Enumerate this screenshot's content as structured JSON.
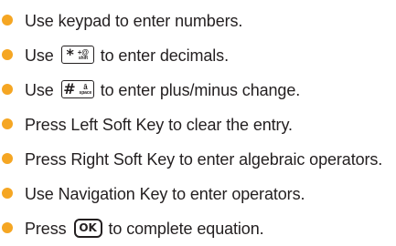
{
  "colors": {
    "bullet": "#f5a623",
    "text": "#231f20"
  },
  "items": [
    {
      "text": "Use keypad to enter numbers."
    },
    {
      "before": "Use",
      "key_main": "*",
      "key_sub_top": "+@",
      "key_sub_bottom": "shift",
      "after": "to enter decimals."
    },
    {
      "before": "Use",
      "key_main": "#",
      "key_sub_top": "â",
      "key_sub_bottom": "space",
      "after": "to enter plus/minus change."
    },
    {
      "text": "Press Left Soft Key to clear the entry."
    },
    {
      "text": "Press Right Soft Key to enter algebraic operators."
    },
    {
      "text": "Use Navigation Key to enter operators."
    },
    {
      "before": "Press",
      "key_label": "OK",
      "after": "to complete equation."
    }
  ]
}
